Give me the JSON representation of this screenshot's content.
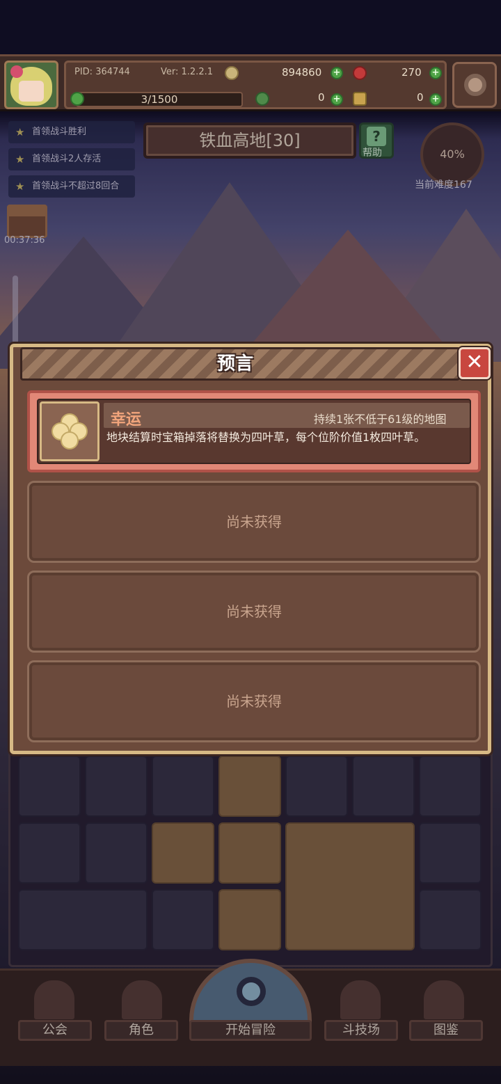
{
  "header": {
    "pid_label": "PID: 364744",
    "version_label": "Ver: 1.2.2.1",
    "gold": "894860",
    "gems": "270",
    "stamina": "3/1500",
    "clover_count": "0",
    "key_count": "0"
  },
  "quests": [
    {
      "label": "首领战斗胜利"
    },
    {
      "label": "首领战斗2人存活"
    },
    {
      "label": "首领战斗不超过8回合"
    }
  ],
  "chest": {
    "timer": "00:37:36"
  },
  "location": {
    "title": "铁血高地[30]",
    "help_label": "帮助"
  },
  "difficulty": {
    "percent": "40%",
    "label": "当前难度167"
  },
  "modal": {
    "title": "预言",
    "close_icon": "close-icon",
    "cards": [
      {
        "name": "幸运",
        "condition": "持续1张不低于61级的地图",
        "description": "地块结算时宝箱掉落将替换为四叶草，每个位阶价值1枚四叶草。",
        "icon": "four-leaf-clover-icon"
      },
      {
        "empty_label": "尚未获得"
      },
      {
        "empty_label": "尚未获得"
      },
      {
        "empty_label": "尚未获得"
      }
    ]
  },
  "nav": {
    "items": [
      {
        "label": "公会",
        "icon": "guild-icon"
      },
      {
        "label": "角色",
        "icon": "character-icon"
      },
      {
        "label": "开始冒险",
        "icon": "magnifier-icon"
      },
      {
        "label": "斗技场",
        "icon": "crossed-swords-icon"
      },
      {
        "label": "图鉴",
        "icon": "book-icon"
      }
    ]
  },
  "colors": {
    "accent_red": "#c8473f",
    "card_pink": "#e28877",
    "panel_brown": "#6c4a3b",
    "gold_border": "#d7b985"
  }
}
